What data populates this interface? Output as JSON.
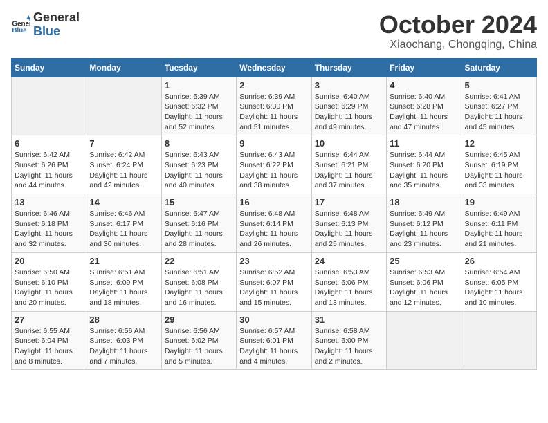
{
  "logo": {
    "general": "General",
    "blue": "Blue"
  },
  "header": {
    "month": "October 2024",
    "location": "Xiaochang, Chongqing, China"
  },
  "weekdays": [
    "Sunday",
    "Monday",
    "Tuesday",
    "Wednesday",
    "Thursday",
    "Friday",
    "Saturday"
  ],
  "weeks": [
    [
      {
        "day": "",
        "sunrise": "",
        "sunset": "",
        "daylight": ""
      },
      {
        "day": "",
        "sunrise": "",
        "sunset": "",
        "daylight": ""
      },
      {
        "day": "1",
        "sunrise": "Sunrise: 6:39 AM",
        "sunset": "Sunset: 6:32 PM",
        "daylight": "Daylight: 11 hours and 52 minutes."
      },
      {
        "day": "2",
        "sunrise": "Sunrise: 6:39 AM",
        "sunset": "Sunset: 6:30 PM",
        "daylight": "Daylight: 11 hours and 51 minutes."
      },
      {
        "day": "3",
        "sunrise": "Sunrise: 6:40 AM",
        "sunset": "Sunset: 6:29 PM",
        "daylight": "Daylight: 11 hours and 49 minutes."
      },
      {
        "day": "4",
        "sunrise": "Sunrise: 6:40 AM",
        "sunset": "Sunset: 6:28 PM",
        "daylight": "Daylight: 11 hours and 47 minutes."
      },
      {
        "day": "5",
        "sunrise": "Sunrise: 6:41 AM",
        "sunset": "Sunset: 6:27 PM",
        "daylight": "Daylight: 11 hours and 45 minutes."
      }
    ],
    [
      {
        "day": "6",
        "sunrise": "Sunrise: 6:42 AM",
        "sunset": "Sunset: 6:26 PM",
        "daylight": "Daylight: 11 hours and 44 minutes."
      },
      {
        "day": "7",
        "sunrise": "Sunrise: 6:42 AM",
        "sunset": "Sunset: 6:24 PM",
        "daylight": "Daylight: 11 hours and 42 minutes."
      },
      {
        "day": "8",
        "sunrise": "Sunrise: 6:43 AM",
        "sunset": "Sunset: 6:23 PM",
        "daylight": "Daylight: 11 hours and 40 minutes."
      },
      {
        "day": "9",
        "sunrise": "Sunrise: 6:43 AM",
        "sunset": "Sunset: 6:22 PM",
        "daylight": "Daylight: 11 hours and 38 minutes."
      },
      {
        "day": "10",
        "sunrise": "Sunrise: 6:44 AM",
        "sunset": "Sunset: 6:21 PM",
        "daylight": "Daylight: 11 hours and 37 minutes."
      },
      {
        "day": "11",
        "sunrise": "Sunrise: 6:44 AM",
        "sunset": "Sunset: 6:20 PM",
        "daylight": "Daylight: 11 hours and 35 minutes."
      },
      {
        "day": "12",
        "sunrise": "Sunrise: 6:45 AM",
        "sunset": "Sunset: 6:19 PM",
        "daylight": "Daylight: 11 hours and 33 minutes."
      }
    ],
    [
      {
        "day": "13",
        "sunrise": "Sunrise: 6:46 AM",
        "sunset": "Sunset: 6:18 PM",
        "daylight": "Daylight: 11 hours and 32 minutes."
      },
      {
        "day": "14",
        "sunrise": "Sunrise: 6:46 AM",
        "sunset": "Sunset: 6:17 PM",
        "daylight": "Daylight: 11 hours and 30 minutes."
      },
      {
        "day": "15",
        "sunrise": "Sunrise: 6:47 AM",
        "sunset": "Sunset: 6:16 PM",
        "daylight": "Daylight: 11 hours and 28 minutes."
      },
      {
        "day": "16",
        "sunrise": "Sunrise: 6:48 AM",
        "sunset": "Sunset: 6:14 PM",
        "daylight": "Daylight: 11 hours and 26 minutes."
      },
      {
        "day": "17",
        "sunrise": "Sunrise: 6:48 AM",
        "sunset": "Sunset: 6:13 PM",
        "daylight": "Daylight: 11 hours and 25 minutes."
      },
      {
        "day": "18",
        "sunrise": "Sunrise: 6:49 AM",
        "sunset": "Sunset: 6:12 PM",
        "daylight": "Daylight: 11 hours and 23 minutes."
      },
      {
        "day": "19",
        "sunrise": "Sunrise: 6:49 AM",
        "sunset": "Sunset: 6:11 PM",
        "daylight": "Daylight: 11 hours and 21 minutes."
      }
    ],
    [
      {
        "day": "20",
        "sunrise": "Sunrise: 6:50 AM",
        "sunset": "Sunset: 6:10 PM",
        "daylight": "Daylight: 11 hours and 20 minutes."
      },
      {
        "day": "21",
        "sunrise": "Sunrise: 6:51 AM",
        "sunset": "Sunset: 6:09 PM",
        "daylight": "Daylight: 11 hours and 18 minutes."
      },
      {
        "day": "22",
        "sunrise": "Sunrise: 6:51 AM",
        "sunset": "Sunset: 6:08 PM",
        "daylight": "Daylight: 11 hours and 16 minutes."
      },
      {
        "day": "23",
        "sunrise": "Sunrise: 6:52 AM",
        "sunset": "Sunset: 6:07 PM",
        "daylight": "Daylight: 11 hours and 15 minutes."
      },
      {
        "day": "24",
        "sunrise": "Sunrise: 6:53 AM",
        "sunset": "Sunset: 6:06 PM",
        "daylight": "Daylight: 11 hours and 13 minutes."
      },
      {
        "day": "25",
        "sunrise": "Sunrise: 6:53 AM",
        "sunset": "Sunset: 6:06 PM",
        "daylight": "Daylight: 11 hours and 12 minutes."
      },
      {
        "day": "26",
        "sunrise": "Sunrise: 6:54 AM",
        "sunset": "Sunset: 6:05 PM",
        "daylight": "Daylight: 11 hours and 10 minutes."
      }
    ],
    [
      {
        "day": "27",
        "sunrise": "Sunrise: 6:55 AM",
        "sunset": "Sunset: 6:04 PM",
        "daylight": "Daylight: 11 hours and 8 minutes."
      },
      {
        "day": "28",
        "sunrise": "Sunrise: 6:56 AM",
        "sunset": "Sunset: 6:03 PM",
        "daylight": "Daylight: 11 hours and 7 minutes."
      },
      {
        "day": "29",
        "sunrise": "Sunrise: 6:56 AM",
        "sunset": "Sunset: 6:02 PM",
        "daylight": "Daylight: 11 hours and 5 minutes."
      },
      {
        "day": "30",
        "sunrise": "Sunrise: 6:57 AM",
        "sunset": "Sunset: 6:01 PM",
        "daylight": "Daylight: 11 hours and 4 minutes."
      },
      {
        "day": "31",
        "sunrise": "Sunrise: 6:58 AM",
        "sunset": "Sunset: 6:00 PM",
        "daylight": "Daylight: 11 hours and 2 minutes."
      },
      {
        "day": "",
        "sunrise": "",
        "sunset": "",
        "daylight": ""
      },
      {
        "day": "",
        "sunrise": "",
        "sunset": "",
        "daylight": ""
      }
    ]
  ]
}
